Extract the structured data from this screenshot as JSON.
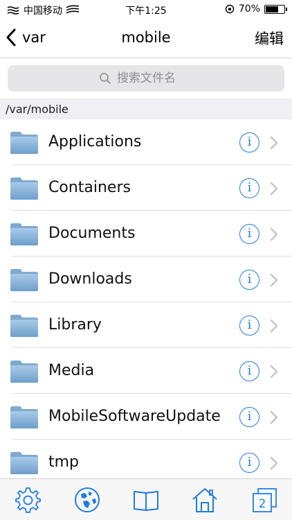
{
  "status_bar": {
    "carrier": "中国移动",
    "time": "下午1:25",
    "battery_text": "70%",
    "battery_level": 0.7
  },
  "nav": {
    "back_label": "var",
    "title": "mobile",
    "edit_label": "编辑"
  },
  "search": {
    "placeholder": "搜索文件名"
  },
  "path": "/var/mobile",
  "folders": [
    {
      "name": "Applications"
    },
    {
      "name": "Containers"
    },
    {
      "name": "Documents"
    },
    {
      "name": "Downloads"
    },
    {
      "name": "Library"
    },
    {
      "name": "Media"
    },
    {
      "name": "MobileSoftwareUpdate"
    },
    {
      "name": "tmp"
    }
  ],
  "tab_bar": {
    "items": [
      {
        "icon": "gear-icon"
      },
      {
        "icon": "globe-icon"
      },
      {
        "icon": "book-icon"
      },
      {
        "icon": "home-icon"
      },
      {
        "icon": "windows-icon",
        "badge": "2"
      }
    ]
  },
  "colors": {
    "accent": "#1e7be4",
    "folder": "#7fb0d9"
  }
}
